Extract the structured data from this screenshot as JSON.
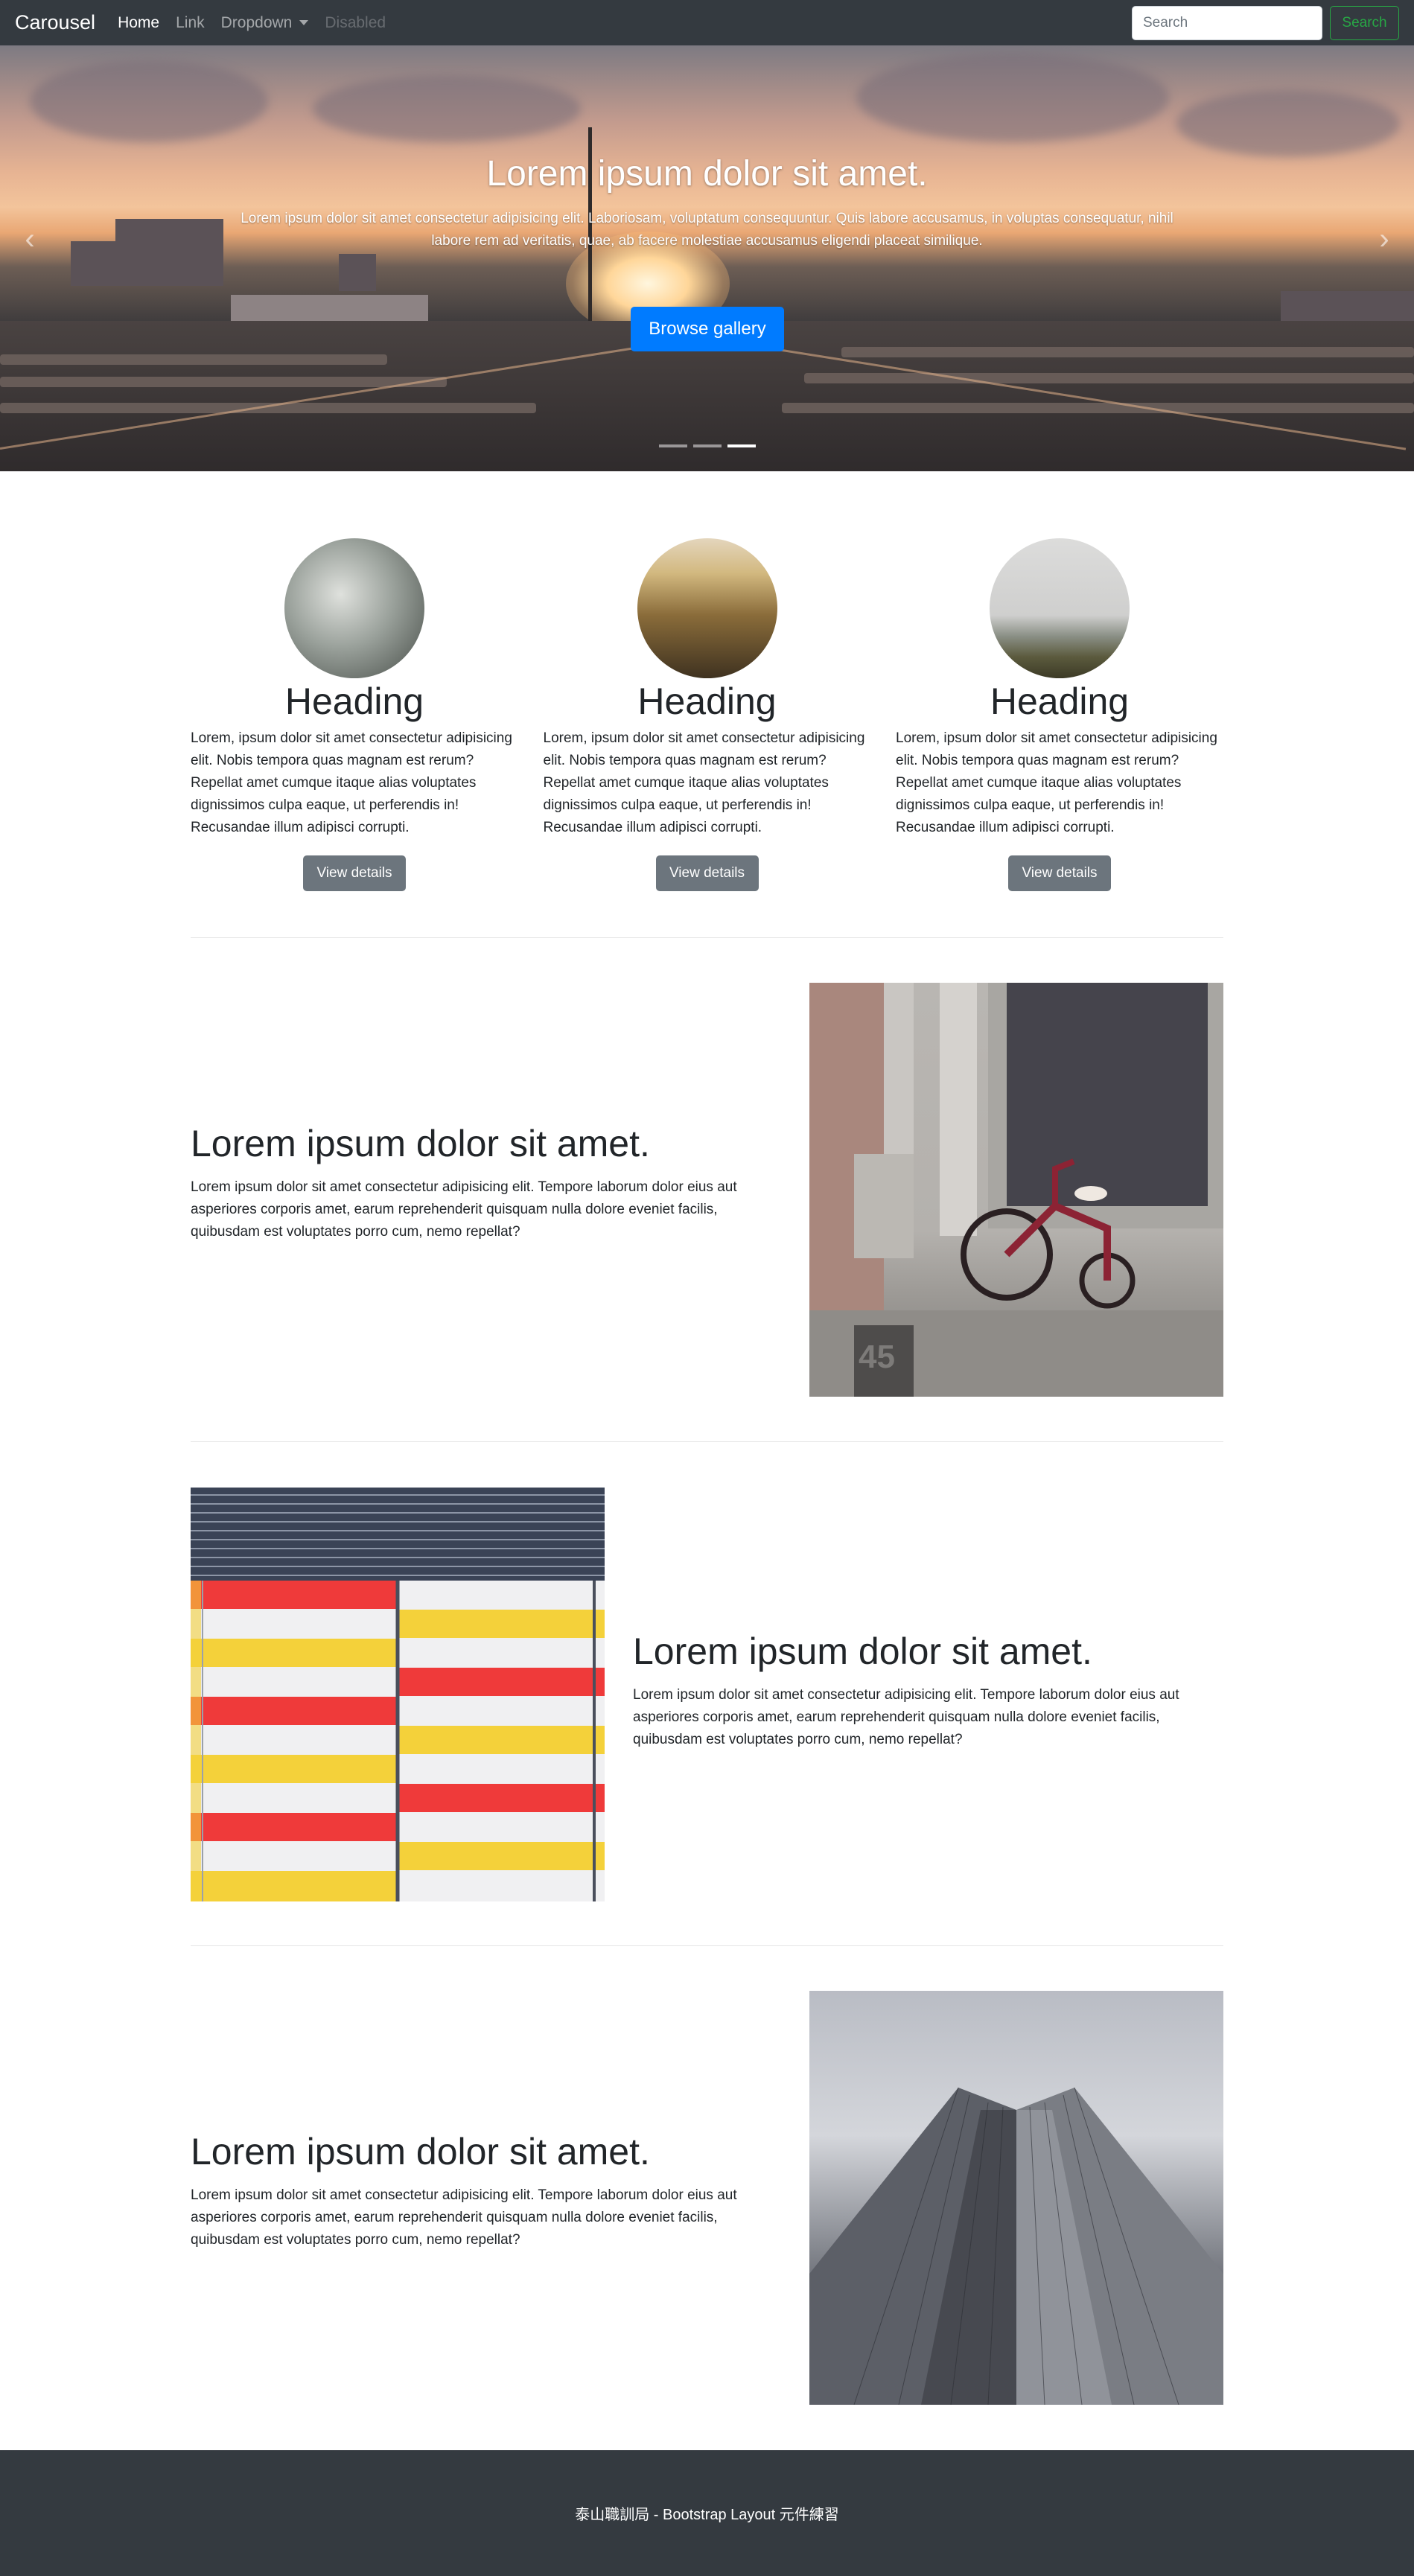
{
  "navbar": {
    "brand": "Carousel",
    "links": [
      {
        "label": "Home",
        "state": "active"
      },
      {
        "label": "Link",
        "state": "normal"
      },
      {
        "label": "Dropdown",
        "state": "dropdown"
      },
      {
        "label": "Disabled",
        "state": "disabled"
      }
    ],
    "search_placeholder": "Search",
    "search_button": "Search"
  },
  "carousel": {
    "title": "Lorem ipsum dolor sit amet.",
    "text": "Lorem ipsum dolor sit amet consectetur adipisicing elit. Laboriosam, voluptatum consequuntur. Quis labore accusamus, in voluptas consequatur, nihil labore rem ad veritatis, quae, ab facere molestiae accusamus eligendi placeat similique.",
    "button": "Browse gallery",
    "indicators": 3,
    "active_indicator": 2
  },
  "marketing": [
    {
      "heading": "Heading",
      "text": "Lorem, ipsum dolor sit amet consectetur adipisicing elit. Nobis tempora quas magnam est rerum? Repellat amet cumque itaque alias voluptates dignissimos culpa eaque, ut perferendis in! Recusandae illum adipisci corrupti.",
      "button": "View details"
    },
    {
      "heading": "Heading",
      "text": "Lorem, ipsum dolor sit amet consectetur adipisicing elit. Nobis tempora quas magnam est rerum? Repellat amet cumque itaque alias voluptates dignissimos culpa eaque, ut perferendis in! Recusandae illum adipisci corrupti.",
      "button": "View details"
    },
    {
      "heading": "Heading",
      "text": "Lorem, ipsum dolor sit amet consectetur adipisicing elit. Nobis tempora quas magnam est rerum? Repellat amet cumque itaque alias voluptates dignissimos culpa eaque, ut perferendis in! Recusandae illum adipisci corrupti.",
      "button": "View details"
    }
  ],
  "featurettes": [
    {
      "heading": "Lorem ipsum dolor sit amet.",
      "lead": "Lorem ipsum dolor sit amet consectetur adipisicing elit. Tempore laborum dolor eius aut asperiores corporis amet, earum reprehenderit quisquam nulla dolore eveniet facilis, quibusdam est voluptates porro cum, nemo repellat?",
      "image_label": "45"
    },
    {
      "heading": "Lorem ipsum dolor sit amet.",
      "lead": "Lorem ipsum dolor sit amet consectetur adipisicing elit. Tempore laborum dolor eius aut asperiores corporis amet, earum reprehenderit quisquam nulla dolore eveniet facilis, quibusdam est voluptates porro cum, nemo repellat?"
    },
    {
      "heading": "Lorem ipsum dolor sit amet.",
      "lead": "Lorem ipsum dolor sit amet consectetur adipisicing elit. Tempore laborum dolor eius aut asperiores corporis amet, earum reprehenderit quisquam nulla dolore eveniet facilis, quibusdam est voluptates porro cum, nemo repellat?"
    }
  ],
  "footer": {
    "text": "泰山職訓局 - Bootstrap Layout 元件練習"
  },
  "colors": {
    "navbar_bg": "#343a40",
    "primary": "#007bff",
    "success": "#28a745",
    "secondary": "#6c757d",
    "footer_bg": "#343a40"
  }
}
